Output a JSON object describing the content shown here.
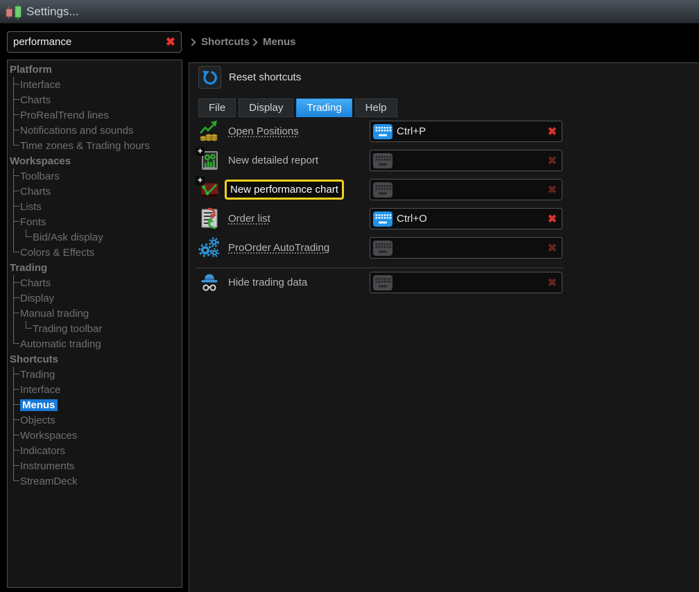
{
  "window": {
    "title": "Settings..."
  },
  "search": {
    "value": "performance",
    "placeholder": ""
  },
  "breadcrumb": {
    "items": [
      {
        "label": "Shortcuts"
      },
      {
        "label": "Menus"
      }
    ]
  },
  "glyphs": {
    "clear": "✖"
  },
  "colors": {
    "accent_blue": "#2e9cf4",
    "selection_blue": "#1779d8",
    "highlight_yellow": "#f2cf1d",
    "danger_red": "#d8322e",
    "dim_red": "#64221f"
  },
  "sidebar": {
    "selected_item": "Menus",
    "items": [
      {
        "label": "Platform"
      },
      {
        "label": "Interface"
      },
      {
        "label": "Charts"
      },
      {
        "label": "ProRealTrend lines"
      },
      {
        "label": "Notifications and sounds"
      },
      {
        "label": "Time zones & Trading hours"
      },
      {
        "label": "Workspaces"
      },
      {
        "label": "Toolbars"
      },
      {
        "label": "Charts"
      },
      {
        "label": "Lists"
      },
      {
        "label": "Fonts"
      },
      {
        "label": "Bid/Ask display"
      },
      {
        "label": "Colors & Effects"
      },
      {
        "label": "Trading"
      },
      {
        "label": "Charts"
      },
      {
        "label": "Display"
      },
      {
        "label": "Manual trading"
      },
      {
        "label": "Trading toolbar"
      },
      {
        "label": "Automatic trading"
      },
      {
        "label": "Shortcuts"
      },
      {
        "label": "Trading"
      },
      {
        "label": "Interface"
      },
      {
        "label": "Menus"
      },
      {
        "label": "Objects"
      },
      {
        "label": "Workspaces"
      },
      {
        "label": "Indicators"
      },
      {
        "label": "Instruments"
      },
      {
        "label": "StreamDeck"
      }
    ]
  },
  "shortcuts_panel": {
    "reset_label": "Reset shortcuts",
    "active_tab": "Trading",
    "tabs": [
      {
        "label": "File"
      },
      {
        "label": "Display"
      },
      {
        "label": "Trading"
      },
      {
        "label": "Help"
      }
    ],
    "rows": [
      {
        "label": "Open Positions",
        "icon": "open-positions-icon",
        "shortcut": "Ctrl+P",
        "assigned": true,
        "underlined": true,
        "highlighted": false
      },
      {
        "label": "New detailed report",
        "icon": "new-detailed-report-icon",
        "shortcut": "",
        "assigned": false,
        "underlined": false,
        "highlighted": false
      },
      {
        "label": "New performance chart",
        "icon": "new-performance-chart-icon",
        "shortcut": "",
        "assigned": false,
        "underlined": false,
        "highlighted": true
      },
      {
        "label": "Order list",
        "icon": "order-list-icon",
        "shortcut": "Ctrl+O",
        "assigned": true,
        "underlined": true,
        "highlighted": false
      },
      {
        "label": "ProOrder AutoTrading",
        "icon": "proorder-autotrading-icon",
        "shortcut": "",
        "assigned": false,
        "underlined": true,
        "highlighted": false
      },
      {
        "label": "Hide trading data",
        "icon": "hide-trading-data-icon",
        "shortcut": "",
        "assigned": false,
        "underlined": false,
        "highlighted": false,
        "separator_above": true
      }
    ]
  }
}
